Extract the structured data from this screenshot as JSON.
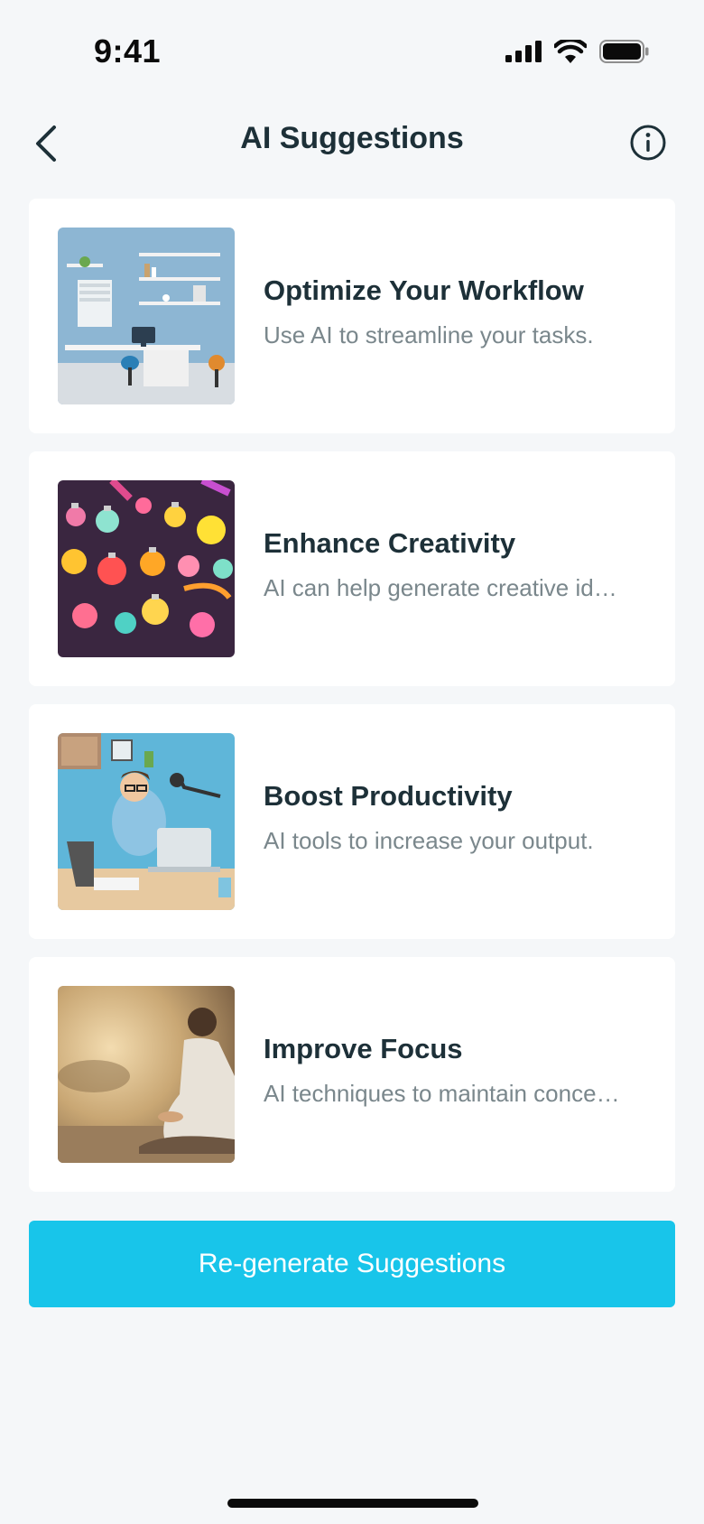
{
  "status_bar": {
    "time": "9:41",
    "icons": [
      "cellular-signal-icon",
      "wifi-icon",
      "battery-icon"
    ]
  },
  "nav": {
    "title": "AI Suggestions",
    "back_icon": "chevron-left-icon",
    "info_icon": "info-icon"
  },
  "suggestions": [
    {
      "title": "Optimize Your Workflow",
      "subtitle": "Use AI to streamline your tasks.",
      "image": "home-office-workspace"
    },
    {
      "title": "Enhance Creativity",
      "subtitle": "AI can help generate creative ideas.",
      "image": "colorful-light-bulbs"
    },
    {
      "title": "Boost Productivity",
      "subtitle": "AI tools to increase your output.",
      "image": "man-working-at-laptop"
    },
    {
      "title": "Improve Focus",
      "subtitle": "AI techniques to maintain concentration.",
      "image": "man-meditating-sunset"
    }
  ],
  "regenerate_button": {
    "label": "Re-generate Suggestions"
  },
  "colors": {
    "background": "#f5f7f9",
    "card": "#ffffff",
    "title_text": "#1d3038",
    "subtitle_text": "#7a878c",
    "accent": "#18c5ea"
  }
}
